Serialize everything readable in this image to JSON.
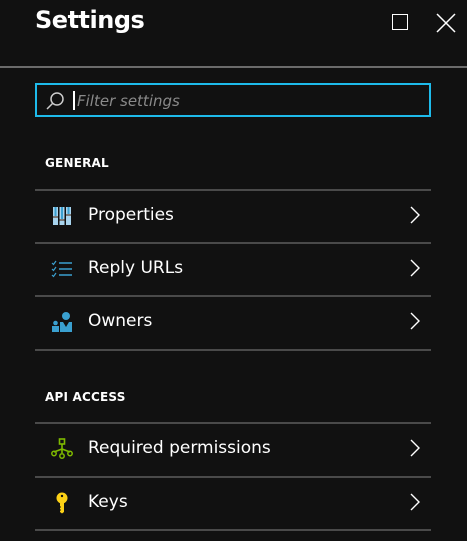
{
  "header": {
    "title": "Settings"
  },
  "search": {
    "placeholder": "Filter settings",
    "value": ""
  },
  "sections": [
    {
      "label": "GENERAL",
      "items": [
        {
          "label": "Properties",
          "icon": "properties-icon"
        },
        {
          "label": "Reply URLs",
          "icon": "checklist-icon"
        },
        {
          "label": "Owners",
          "icon": "owners-icon"
        }
      ]
    },
    {
      "label": "API ACCESS",
      "items": [
        {
          "label": "Required permissions",
          "icon": "permissions-icon"
        },
        {
          "label": "Keys",
          "icon": "key-icon"
        }
      ]
    }
  ],
  "colors": {
    "accent": "#1ebbeb",
    "icon_blue": "#3aa0d0",
    "icon_green": "#7fba00",
    "icon_yellow": "#fcd116"
  }
}
